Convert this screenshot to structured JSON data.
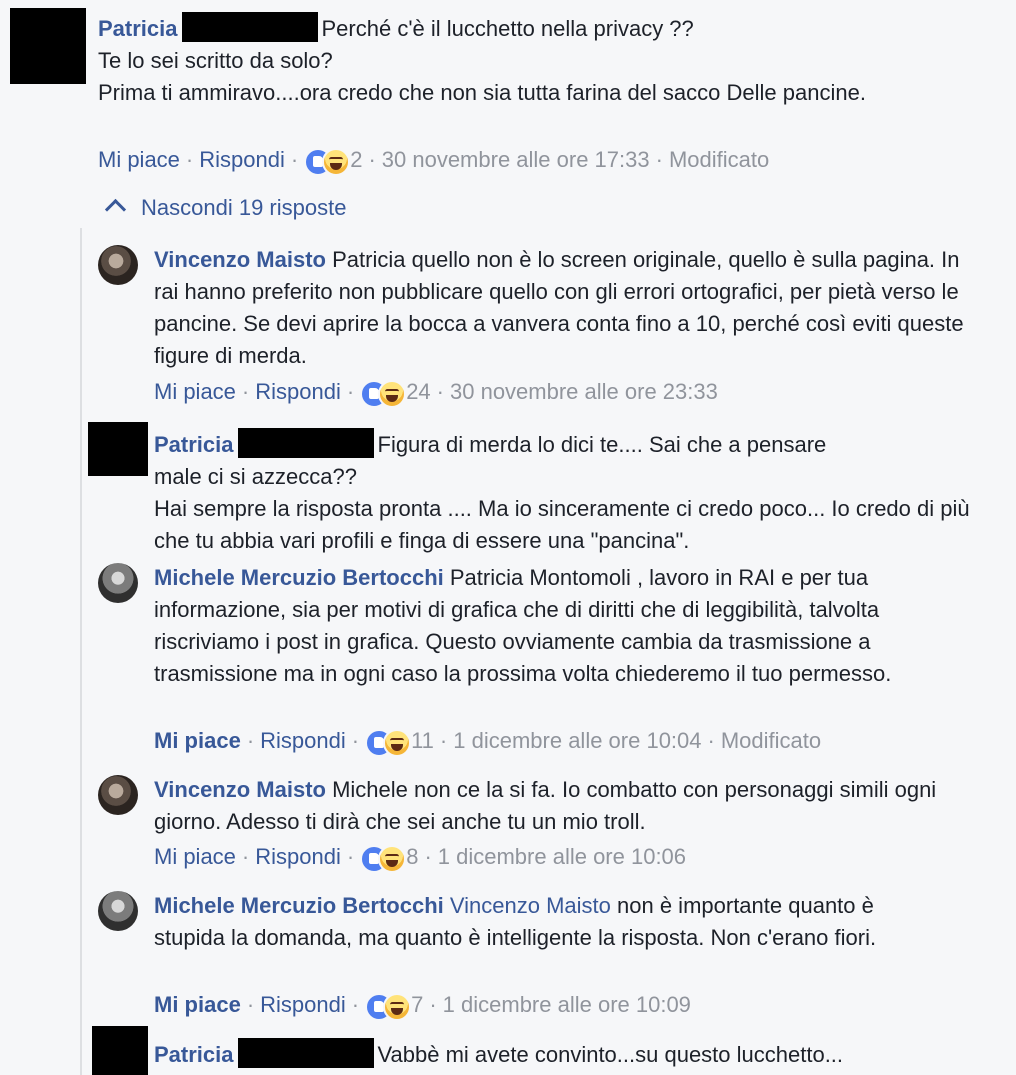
{
  "c1": {
    "name": "Patricia",
    "body_first": "Perché c'è il lucchetto nella privacy ??",
    "body_rest": "Te lo sei scritto da solo?",
    "body_rest2": "Prima ti ammiravo....ora credo che non sia tutta farina del sacco Delle pancine.",
    "like": "Mi piace",
    "reply": "Rispondi",
    "count": "2",
    "time": "30 novembre alle ore 17:33",
    "edited": "Modificato"
  },
  "toggle": {
    "label": "Nascondi 19 risposte"
  },
  "r1": {
    "name": "Vincenzo Maisto",
    "body": "Patricia quello non è lo screen originale, quello è sulla pagina. In rai hanno preferito non pubblicare quello con gli errori ortografici, per pietà verso le pancine. Se devi aprire la bocca a vanvera conta fino a 10, perché così eviti queste figure di merda.",
    "like": "Mi piace",
    "reply": "Rispondi",
    "count": "24",
    "time": "30 novembre alle ore 23:33"
  },
  "r2": {
    "name": "Patricia",
    "body_first": "Figura di merda lo dici te.... Sai che a pensare",
    "body_first2": "male ci si azzecca??",
    "body_rest": "Hai sempre la risposta pronta .... Ma io sinceramente ci credo poco... Io credo di più che tu abbia vari profili e finga di essere una \"pancina\"."
  },
  "r3": {
    "name": "Michele Mercuzio Bertocchi",
    "body": "Patricia Montomoli , lavoro in RAI e per tua informazione, sia per motivi di grafica che di diritti che di leggibilità, talvolta riscriviamo i post in grafica. Questo ovviamente cambia da trasmissione a trasmissione ma in ogni caso la prossima volta chiederemo il tuo permesso.",
    "like": "Mi piace",
    "reply": "Rispondi",
    "count": "11",
    "time": "1 dicembre alle ore 10:04",
    "edited": "Modificato"
  },
  "r4": {
    "name": "Vincenzo Maisto",
    "body": "Michele non ce la si fa. Io combatto con personaggi simili ogni giorno. Adesso ti dirà che sei anche tu un mio troll.",
    "like": "Mi piace",
    "reply": "Rispondi",
    "count": "8",
    "time": "1 dicembre alle ore 10:06"
  },
  "r5": {
    "name": "Michele Mercuzio Bertocchi",
    "mention": "Vincenzo Maisto",
    "body": "non è importante quanto è stupida la domanda, ma quanto è intelligente la risposta. Non c'erano fiori.",
    "like": "Mi piace",
    "reply": "Rispondi",
    "count": "7",
    "time": "1 dicembre alle ore 10:09"
  },
  "r6": {
    "name": "Patricia",
    "body": "Vabbè mi avete convinto...su questo lucchetto..."
  }
}
